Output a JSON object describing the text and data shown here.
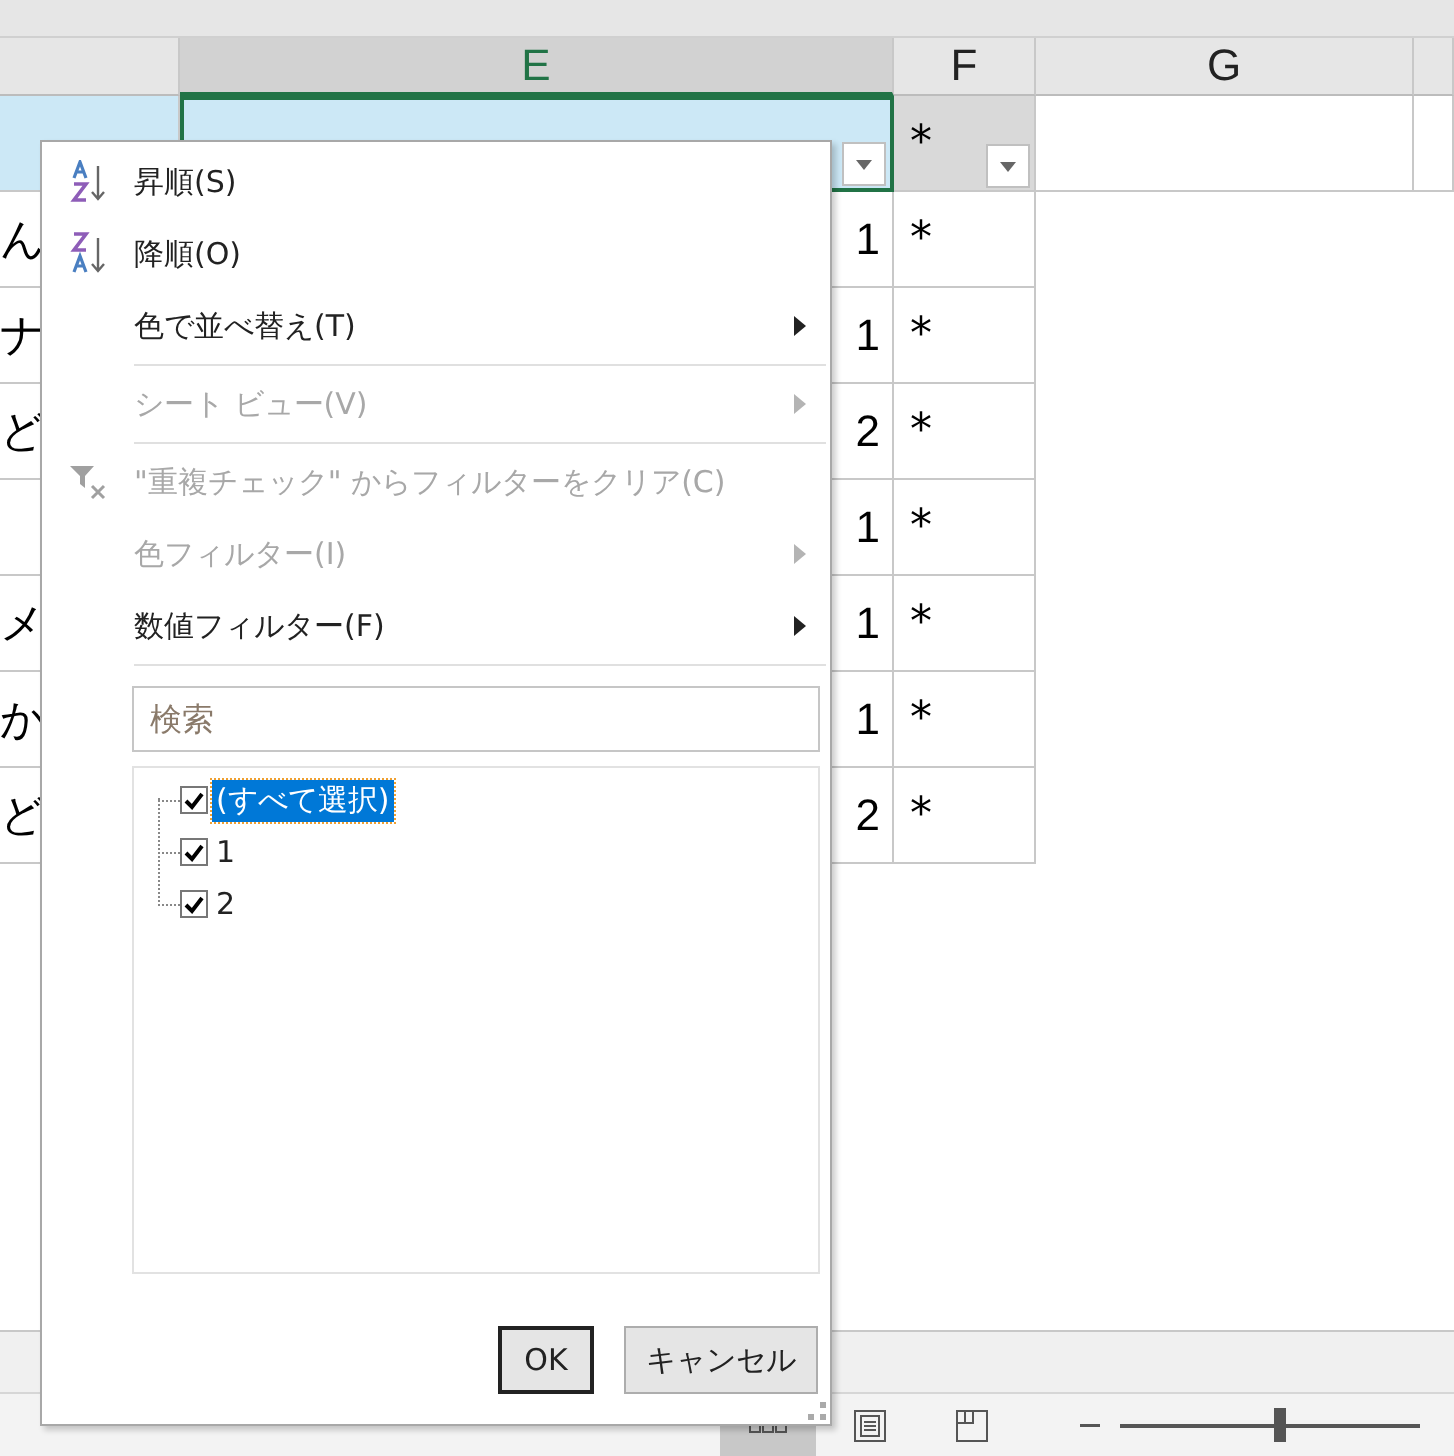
{
  "columns": [
    {
      "label": "E",
      "selected": true
    },
    {
      "label": "F",
      "selected": false
    },
    {
      "label": "G",
      "selected": false
    }
  ],
  "header_row": {
    "f": "*"
  },
  "rows": [
    {
      "a": "ん",
      "e": "1",
      "f": "*"
    },
    {
      "a": "ナ",
      "e": "1",
      "f": "*"
    },
    {
      "a": "ど",
      "e": "2",
      "f": "*"
    },
    {
      "e": "1",
      "f": "*"
    },
    {
      "a": "メ",
      "e": "1",
      "f": "*"
    },
    {
      "a": "か",
      "e": "1",
      "f": "*"
    },
    {
      "a": "ど",
      "e": "2",
      "f": "*"
    }
  ],
  "menu": {
    "items": [
      {
        "kind": "ascending",
        "label": "昇順(S)",
        "disabled": false,
        "submenu": false
      },
      {
        "kind": "descending",
        "label": "降順(O)",
        "disabled": false,
        "submenu": false
      },
      {
        "kind": "plain",
        "label": "色で並べ替え(T)",
        "disabled": false,
        "submenu": true
      },
      {
        "kind": "separator"
      },
      {
        "kind": "plain",
        "label": "シート ビュー(V)",
        "disabled": true,
        "submenu": true
      },
      {
        "kind": "separator"
      },
      {
        "kind": "clearfilter",
        "label": "\"重複チェック\" からフィルターをクリア(C)",
        "disabled": true,
        "submenu": false
      },
      {
        "kind": "plain",
        "label": "色フィルター(I)",
        "disabled": true,
        "submenu": true
      },
      {
        "kind": "plain",
        "label": "数値フィルター(F)",
        "disabled": false,
        "submenu": true
      },
      {
        "kind": "separator"
      }
    ],
    "search": {
      "placeholder": "検索"
    },
    "values": [
      {
        "label": "(すべて選択)",
        "checked": true,
        "selected": true
      },
      {
        "label": "1",
        "checked": true,
        "selected": false
      },
      {
        "label": "2",
        "checked": true,
        "selected": false
      }
    ],
    "buttons": [
      {
        "label": "OK",
        "default": true
      },
      {
        "label": "キャンセル",
        "default": false
      }
    ]
  },
  "status_bar": {
    "views": [
      {
        "kind": "normal",
        "selected": true
      },
      {
        "kind": "layout",
        "selected": false
      },
      {
        "kind": "pagebreak",
        "selected": false
      }
    ],
    "zoom": {
      "level": 0.53
    }
  }
}
